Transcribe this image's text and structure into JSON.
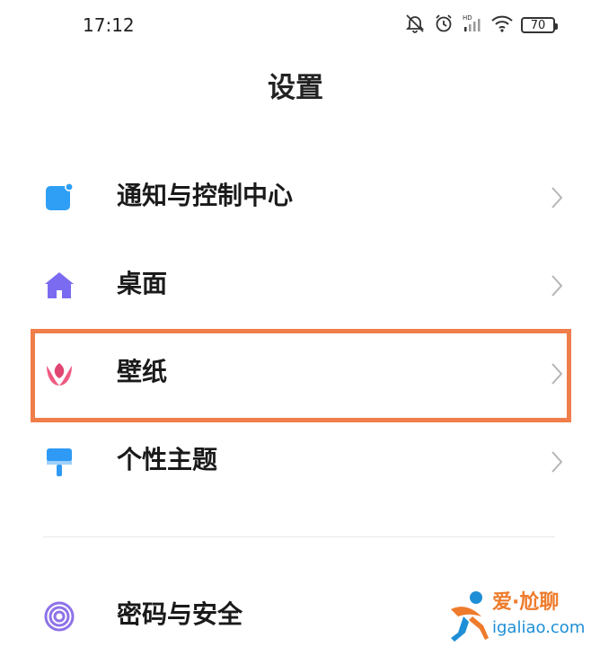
{
  "status_bar": {
    "time": "17:12",
    "icons": [
      "silent-bell-icon",
      "alarm-icon",
      "hd-signal-icon",
      "wifi-icon",
      "battery-icon"
    ],
    "battery_level": "70"
  },
  "header": {
    "title": "设置"
  },
  "settings": {
    "items": [
      {
        "label": "通知与控制中心",
        "icon": "notification-icon",
        "icon_color": "#2e9ff5"
      },
      {
        "label": "桌面",
        "icon": "home-icon",
        "icon_color": "#7b6bf0"
      },
      {
        "label": "壁纸",
        "icon": "tulip-icon",
        "icon_color": "#ef5a82",
        "highlighted": true
      },
      {
        "label": "个性主题",
        "icon": "paint-roller-icon",
        "icon_color": "#2f9af5"
      },
      {
        "label": "密码与安全",
        "icon": "fingerprint-icon",
        "icon_color": "#8e72e8"
      }
    ]
  },
  "highlight": {
    "color": "#f07e4b"
  },
  "watermark": {
    "brand": "爱·尬聊",
    "url": "igaliao.com"
  }
}
